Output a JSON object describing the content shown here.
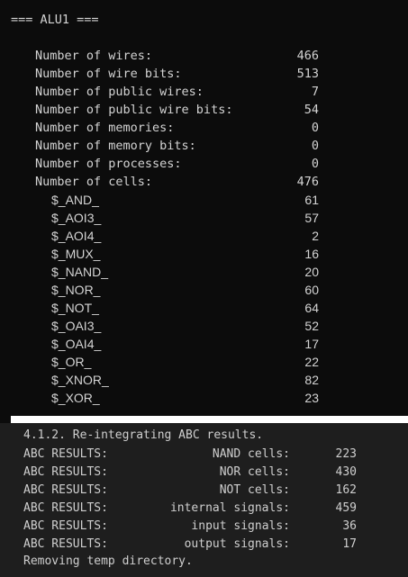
{
  "header": "=== ALU1 ===",
  "stats": [
    {
      "label": "Number of wires:",
      "value": "466"
    },
    {
      "label": "Number of wire bits:",
      "value": "513"
    },
    {
      "label": "Number of public wires:",
      "value": "7"
    },
    {
      "label": "Number of public wire bits:",
      "value": "54"
    },
    {
      "label": "Number of memories:",
      "value": "0"
    },
    {
      "label": "Number of memory bits:",
      "value": "0"
    },
    {
      "label": "Number of processes:",
      "value": "0"
    },
    {
      "label": "Number of cells:",
      "value": "476"
    }
  ],
  "cells": [
    {
      "name": "$_AND_",
      "count": "61"
    },
    {
      "name": "$_AOI3_",
      "count": "57"
    },
    {
      "name": "$_AOI4_",
      "count": "2"
    },
    {
      "name": "$_MUX_",
      "count": "16"
    },
    {
      "name": "$_NAND_",
      "count": "20"
    },
    {
      "name": "$_NOR_",
      "count": "60"
    },
    {
      "name": "$_NOT_",
      "count": "64"
    },
    {
      "name": "$_OAI3_",
      "count": "52"
    },
    {
      "name": "$_OAI4_",
      "count": "17"
    },
    {
      "name": "$_OR_",
      "count": "22"
    },
    {
      "name": "$_XNOR_",
      "count": "82"
    },
    {
      "name": "$_XOR_",
      "count": "23"
    }
  ],
  "abc": {
    "title": "4.1.2. Re-integrating ABC results.",
    "prefix": "ABC RESULTS:",
    "rows": [
      {
        "label": "NAND cells:",
        "value": "223"
      },
      {
        "label": "NOR cells:",
        "value": "430"
      },
      {
        "label": "NOT cells:",
        "value": "162"
      },
      {
        "label": "internal signals:",
        "value": "459"
      },
      {
        "label": "input signals:",
        "value": "36"
      },
      {
        "label": "output signals:",
        "value": "17"
      }
    ],
    "footer": "Removing temp directory."
  }
}
